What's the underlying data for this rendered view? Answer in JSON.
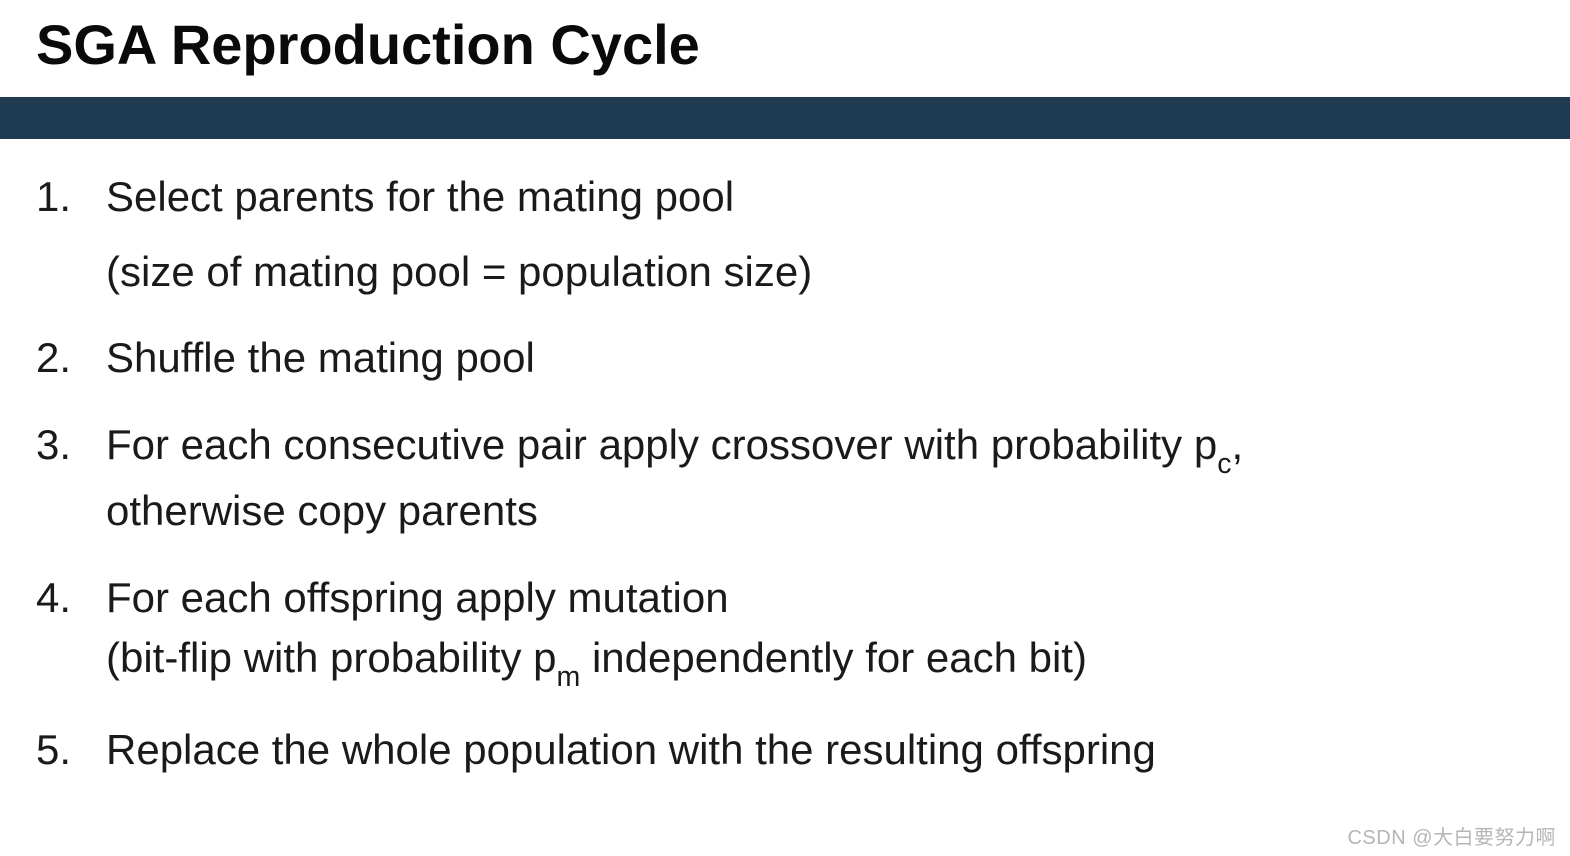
{
  "title": "SGA Reproduction Cycle",
  "steps": {
    "s1_line1": "Select parents for the mating pool",
    "s1_line2": "(size of mating pool = population size)",
    "s2": "Shuffle the mating pool",
    "s3_pre": "For each consecutive pair apply crossover with probability p",
    "s3_sub": "c",
    "s3_post": ",",
    "s3_line2": "otherwise copy parents",
    "s4_line1": "For each offspring apply mutation",
    "s4_line2_pre": "(bit-flip with probability p",
    "s4_line2_sub": "m",
    "s4_line2_post": " independently for each bit)",
    "s5": "Replace the whole population with the resulting offspring"
  },
  "watermark": "CSDN @大白要努力啊"
}
